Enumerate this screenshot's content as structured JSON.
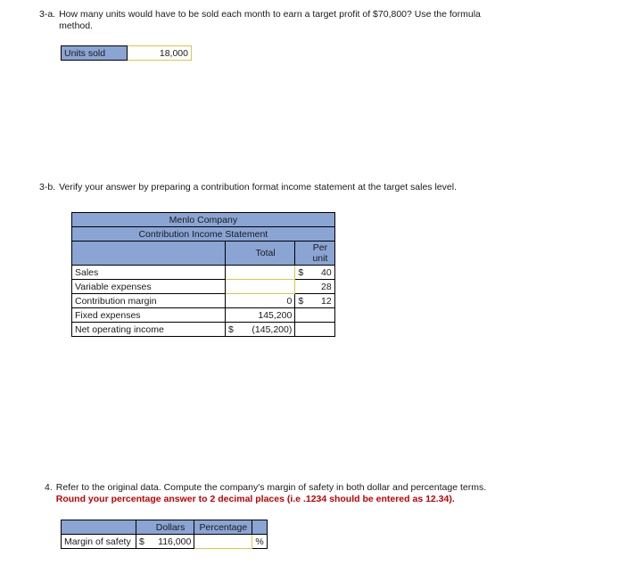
{
  "questions": {
    "q3a": {
      "number": "3-a.",
      "text": "How many units would have to be sold each month to earn a target profit of $70,800? Use the formula method."
    },
    "q3b": {
      "number": "3-b.",
      "text": "Verify your answer by preparing a contribution format income statement at the target sales level."
    },
    "q4": {
      "number": "4.",
      "text_plain": "Refer to the original data. Compute the company's margin of safety in both dollar and percentage terms. ",
      "text_red": "Round your percentage answer to 2 decimal places (i.e .1234 should be entered as 12.34)."
    }
  },
  "units_sold_table": {
    "label": "Units sold",
    "value": "18,000"
  },
  "contribution_statement": {
    "company_title": "Menlo Company",
    "statement_title": "Contribution Income Statement",
    "col_total": "Total",
    "col_per_unit": "Per unit",
    "rows": [
      {
        "label": "Sales",
        "total": "",
        "total_sign": "",
        "per_unit": "40",
        "per_unit_sign": "$"
      },
      {
        "label": "Variable expenses",
        "total": "",
        "total_sign": "",
        "per_unit": "28",
        "per_unit_sign": ""
      },
      {
        "label": "Contribution margin",
        "total": "0",
        "total_sign": "",
        "per_unit": "12",
        "per_unit_sign": "$"
      },
      {
        "label": "Fixed expenses",
        "total": "145,200",
        "total_sign": "",
        "per_unit": "",
        "per_unit_sign": ""
      },
      {
        "label": "Net operating income",
        "total": "(145,200)",
        "total_sign": "$",
        "per_unit": "",
        "per_unit_sign": ""
      }
    ]
  },
  "margin_of_safety": {
    "col_dollars": "Dollars",
    "col_percentage": "Percentage",
    "row_label": "Margin of safety",
    "dollar_sign": "$",
    "dollar_value": "116,000",
    "percentage_value": "",
    "percent_symbol": "%"
  },
  "colors": {
    "header_blue": "#8aa4d4",
    "input_border": "#d4c94a",
    "red_text": "#c00000",
    "border": "#000000"
  }
}
